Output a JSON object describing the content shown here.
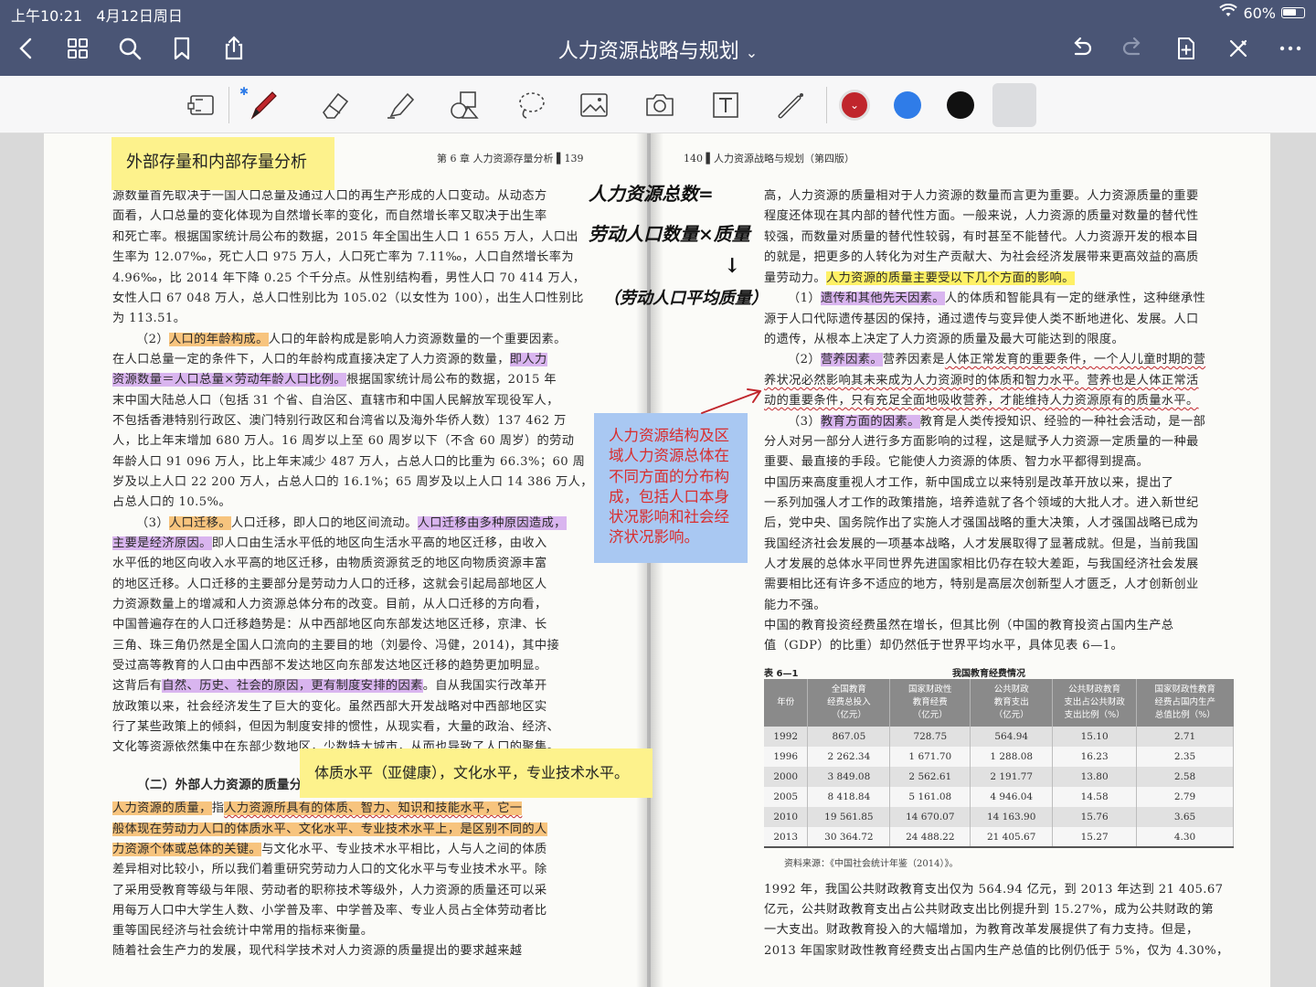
{
  "status": {
    "time": "上午10:21",
    "date": "4月12日周日",
    "battery": "60%"
  },
  "nav": {
    "title": "人力资源战略与规划",
    "chevron": "⌄"
  },
  "toolbar": {
    "tools": [
      "page-view",
      "pen",
      "eraser",
      "highlighter",
      "shapes",
      "lasso",
      "image",
      "camera",
      "text",
      "laser"
    ],
    "colors": [
      "#c0262c",
      "#2f7ce8",
      "#111111"
    ]
  },
  "left": {
    "header": "第 6 章   人力资源存量分析  ▌139",
    "lines": [
      "源数量首先取决于一国人口总量及通过人口的再生产形成的人口变动。从动态方",
      "面看，人口总量的变化体现为自然增长率的变化，而自然增长率又取决于出生率",
      "和死亡率。根据国家统计局公布的数据，2015 年全国出生人口 1 655 万人，人口出",
      "生率为 12.07‰，死亡人口 975 万人，人口死亡率为 7.11‰，人口自然增长率为",
      "4.96‰，比 2014 年下降 0.25 个千分点。从性别结构看，男性人口 70 414 万人，",
      "女性人口 67 048 万人，总人口性别比为 105.02（以女性为 100），出生人口性别比",
      "为 113.51。"
    ],
    "age_lead": "（2）",
    "age_hl": "人口的年龄构成。",
    "age_rest": "人口的年龄构成是影响人力资源数量的一个重要因素。",
    "age_line2a": "在人口总量一定的条件下，人口的年龄构成直接决定了人力资源的数量，",
    "age_line2b": "即人力",
    "age_line3a": "资源数量＝人口总量×劳动年龄人口比例。",
    "age_line3b": "根据国家统计局公布的数据，2015 年",
    "age_lines": [
      "末中国大陆总人口（包括 31 个省、自治区、直辖市和中国人民解放军现役军人，",
      "不包括香港特别行政区、澳门特别行政区和台湾省以及海外华侨人数）137 462 万",
      "人，比上年末增加 680 万人。16 周岁以上至 60 周岁以下（不含 60 周岁）的劳动",
      "年龄人口 91 096 万人，比上年末减少 487 万人，占总人口的比重为 66.3%；60 周",
      "岁及以上人口 22 200 万人，占总人口的 16.1%；65 周岁及以上人口 14 386 万人，",
      "占总人口的 10.5%。"
    ],
    "mig_lead": "（3）",
    "mig_hl": "人口迁移。",
    "mig_rest": "人口迁移，即人口的地区间流动。",
    "mig_hl2": "人口迁移由多种原因造成，",
    "mig_hl3": "主要是经济原因。",
    "mig_rest2": "即人口由生活水平低的地区向生活水平高的地区迁移，由收入",
    "mig_lines": [
      "水平低的地区向收入水平高的地区迁移，由物质资源贫乏的地区向物质资源丰富",
      "的地区迁移。人口迁移的主要部分是劳动力人口的迁移，这就会引起局部地区人",
      "力资源数量上的增减和人力资源总体分布的改变。目前，从人口迁移的方向看，",
      "中国普遍存在的人口迁移趋势是：从中西部地区向东部发达地区迁移，京津、长",
      "三角、珠三角仍然是全国人口流向的主要目的地（刘晏伶、冯健，2014)，其中接",
      "受过高等教育的人口由中西部不发达地区向东部发达地区迁移的趋势更加明显。"
    ],
    "mig_last_a": "这背后有",
    "mig_last_hl": "自然、历史、社会的原因，更有制度安排的因素",
    "mig_last_b": "。自从我国实行改革开",
    "mig_tail": [
      "放政策以来，社会经济发生了巨大的变化。虽然西部大开发战略对中西部地区实",
      "行了某些政策上的倾斜，但因为制度安排的惯性，从现实看，大量的政治、经济、",
      "文化等资源依然集中在东部少数地区，少数特大城市，从而也导致了人口的聚集。"
    ],
    "section2": "（二）外部人力资源的质量分",
    "q_hl1": "人力资源的质量，",
    "q_a": "指",
    "q_hl2": "人力资源所具有的体质、智力、知识和技能水平，它一",
    "q_hl3": "般体现在劳动力人口的体质水平、文化水平、专业技术水平上，是区别不同的人",
    "q_hl4": "力资源个体或总体的关键。",
    "q_b": "与文化水平、专业技术水平相比，人与人之间的体质",
    "q_lines": [
      "差异相对比较小，所以我们着重研究劳动力人口的文化水平与专业技术水平。除",
      "了采用受教育等级与年限、劳动者的职称技术等级外，人力资源的质量还可以采",
      "用每万人口中大学生人数、小学普及率、中学普及率、专业人员占全体劳动者比",
      "重等国民经济与社会统计中常用的指标来衡量。",
      "    随着社会生产力的发展，现代科学技术对人力资源的质量提出的要求越来越"
    ]
  },
  "right": {
    "header": "140 ▌人力资源战略与规划（第四版）",
    "top_lines": [
      "高，人力资源的质量相对于人力资源的数量而言更为重要。人力资源质量的重要",
      "程度还体现在其内部的替代性方面。一般来说，人力资源的质量对数量的替代性",
      "较强，而数量对质量的替代性较弱，有时甚至不能替代。人力资源开发的根本目",
      "的就是，把更多的人转化为对生产贡献大、为社会经济发展带来更高效益的高质"
    ],
    "top_last_a": "量劳动力。",
    "top_last_hl": "人力资源的质量主要受以下几个方面的影响。",
    "g1_lead": "（1）",
    "g1_hl": "遗传和其他先天因素。",
    "g1_rest": "人的体质和智能具有一定的继承性，这种继承性",
    "g1_lines": [
      "源于人口代际遗传基因的保持，通过遗传与变异使人类不断地进化、发展。人口",
      "的遗传，从根本上决定了人力资源的质量及最大可能达到的限度。"
    ],
    "g2_lead": "（2）",
    "g2_hl": "营养因素。",
    "g2_a": "营养因素是",
    "g2_ul1": "人体正常发育的重要条件，一个人儿童时期的营",
    "g2_ul2": "养状况必然影响其未来成为人力资源时的体质和智力水平。营养也是人体正常活",
    "g2_ul3": "动的重要条件，只有充足全面地吸收营养，才能维持人力资源原有的质量水平。",
    "g3_lead": "（3）",
    "g3_hl": "教育方面的因素。",
    "g3_rest": "教育是人类传授知识、经验的一种社会活动，是一部",
    "g3_lines": [
      "分人对另一部分人进行多方面影响的过程，这是赋予人力资源一定质量的一种最",
      "重要、最直接的手段。它能使人力资源的体质、智力水平都得到提高。",
      "    中国历来高度重视人才工作，新中国成立以来特别是改革开放以来，提出了",
      "一系列加强人才工作的政策措施，培养造就了各个领域的大批人才。进入新世纪",
      "后，党中央、国务院作出了实施人才强国战略的重大决策，人才强国战略已成为",
      "我国经济社会发展的一项基本战略，人才发展取得了显著成就。但是，当前我国",
      "人才发展的总体水平同世界先进国家相比仍存在较大差距，与我国经济社会发展",
      "需要相比还有许多不适应的地方，特别是高层次创新型人才匮乏，人才创新创业",
      "能力不强。",
      "    中国的教育投资经费虽然在增长，但其比例（中国的教育投资占国内生产总",
      "值（GDP）的比重）却仍然低于世界平均水平，具体见表 6—1。"
    ],
    "table": {
      "label": "表 6—1",
      "title": "我国教育经费情况",
      "headers": [
        "年份",
        "全国教育\n经费总投入\n（亿元）",
        "国家财政性\n教育经费\n（亿元）",
        "公共财政\n教育支出\n（亿元）",
        "公共财政教育\n支出占公共财政\n支出比例（%）",
        "国家财政性教育\n经费占国内生产\n总值比例（%）"
      ],
      "rows": [
        [
          "1992",
          "867.05",
          "728.75",
          "564.94",
          "15.10",
          "2.71"
        ],
        [
          "1996",
          "2 262.34",
          "1 671.70",
          "1 288.08",
          "16.23",
          "2.35"
        ],
        [
          "2000",
          "3 849.08",
          "2 562.61",
          "2 191.77",
          "13.80",
          "2.58"
        ],
        [
          "2005",
          "8 418.84",
          "5 161.08",
          "4 946.04",
          "14.58",
          "2.79"
        ],
        [
          "2010",
          "19 561.85",
          "14 670.07",
          "14 163.90",
          "15.76",
          "3.65"
        ],
        [
          "2013",
          "30 364.72",
          "24 488.22",
          "21 405.67",
          "15.27",
          "4.30"
        ]
      ],
      "source": "资料来源：《中国社会统计年鉴（2014）》。"
    },
    "bottom_lines": [
      "    1992 年，我国公共财政教育支出仅为 564.94 亿元，到 2013 年达到 21 405.67",
      "亿元，公共财政教育支出占公共财政支出比例提升到 15.27%，成为公共财政的第",
      "一大支出。财政教育投入的大幅增加，为教育改革发展提供了有力支持。但是，",
      "2013 年国家财政性教育经费支出占国内生产总值的比例仍低于 5%，仅为 4.30%，"
    ]
  },
  "notes": {
    "sticky1": "外部存量和内部存量分析",
    "sticky2": "人力资源结构及区域人力资源总体在不同方面的分布构成，包括人口本身状况影响和社会经济状况影响。",
    "sticky3": "体质水平（亚健康），文化水平，专业技术水平。",
    "hand1": "人力资源总数=",
    "hand2": "劳动人口数量×质量",
    "hand3": "（劳动人口平均质量）",
    "hand_arrow": "↓"
  }
}
